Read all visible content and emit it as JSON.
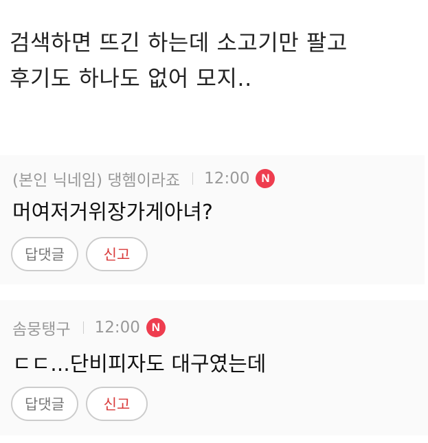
{
  "post": {
    "body": "검색하면 뜨긴 하는데 소고기만 팔고 후기도 하나도 없어 모지.."
  },
  "comments": [
    {
      "author": "(본인 닉네임) 댕헴이라죠",
      "time": "12:00",
      "badge": "N",
      "text": "머여저거위장가게아녀?",
      "reply_label": "답댓글",
      "report_label": "신고"
    },
    {
      "author": "솜뭉탱구",
      "time": "12:00",
      "badge": "N",
      "text": "ㄷㄷ...단비피자도 대구였는데",
      "reply_label": "답댓글",
      "report_label": "신고"
    }
  ],
  "colors": {
    "badge_red": "#ee3d4f",
    "report_red": "#d93a3a",
    "comment_bg": "#fafafa",
    "meta_gray": "#999999"
  },
  "icons": {
    "new_badge": "new-badge-icon"
  }
}
